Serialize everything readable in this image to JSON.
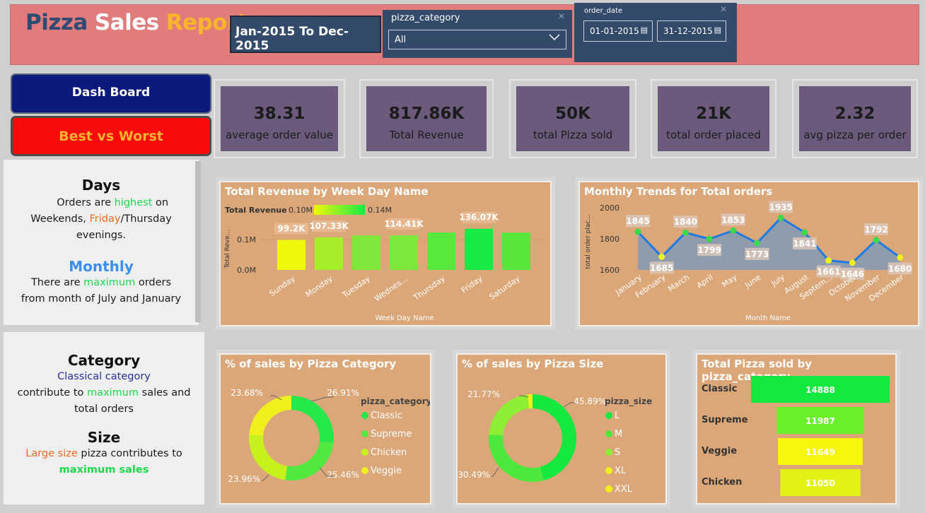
{
  "header": {
    "title_words": [
      "Pizza",
      "Sales",
      "Report"
    ],
    "title_colors": [
      "#2f4a73",
      "#ffffff",
      "#f8b52c"
    ],
    "date_range": "Jan-2015 To Dec-2015",
    "category_slicer": {
      "label": "pizza_category",
      "value": "All"
    },
    "date_slicer": {
      "label": "order_date",
      "from": "01-01-2015",
      "to": "31-12-2015"
    }
  },
  "nav": {
    "dashboard": "Dash Board",
    "best_worst": "Best vs Worst"
  },
  "kpis": [
    {
      "value": "38.31",
      "label": "average order value"
    },
    {
      "value": "817.86K",
      "label": "Total Revenue"
    },
    {
      "value": "50K",
      "label": "total Pizza sold"
    },
    {
      "value": "21K",
      "label": "total order placed"
    },
    {
      "value": "2.32",
      "label": "avg pizza per order"
    }
  ],
  "insights": {
    "days_title": "Days",
    "days_p1": "Orders are ",
    "days_hl1": "highest",
    "days_p2": " on",
    "days_p3": "Weekends, ",
    "days_hl2": "Friday",
    "days_p4": "/Thursday",
    "days_p5": "evenings.",
    "monthly_title": "Monthly",
    "monthly_p1": "There are ",
    "monthly_hl": "maximum",
    "monthly_p2": " orders",
    "monthly_p3": "from month of July and January",
    "category_title": "Category",
    "category_hl1": "Classical category",
    "category_p1": "contribute to ",
    "category_hl2": "maximum",
    "category_p2": " sales and",
    "category_p3": "total orders",
    "size_title": "Size",
    "size_hl1": "Large size",
    "size_p1": " pizza contributes to",
    "size_hl2": "maximum sales"
  },
  "chart_data": [
    {
      "type": "bar",
      "title": "Total Revenue by Week Day Name",
      "xlabel": "Week Day Name",
      "ylabel": "Total Reve...",
      "legend_title": "Total Revenue",
      "legend_min": "0.10M",
      "legend_max": "0.14M",
      "yticks": [
        "0.0M",
        "0.1M"
      ],
      "ylim": [
        0,
        140000
      ],
      "categories": [
        "Sunday",
        "Monday",
        "Tuesday",
        "Wednes...",
        "Thursday",
        "Friday",
        "Saturday"
      ],
      "values": [
        99200,
        107330,
        114000,
        114410,
        123500,
        136070,
        123200
      ],
      "data_labels": [
        "99.2K",
        "107.33K",
        "",
        "114.41K",
        "",
        "136.07K",
        ""
      ],
      "colors": [
        "#eef80a",
        "#a6ee2a",
        "#7de83a",
        "#7be83b",
        "#57e83d",
        "#17ea45",
        "#58e53c"
      ]
    },
    {
      "type": "line",
      "title": "Monthly Trends for Total orders",
      "xlabel": "Month Name",
      "ylabel": "total order plac...",
      "yticks": [
        "1600",
        "1800",
        "2000"
      ],
      "ylim": [
        1600,
        2000
      ],
      "categories": [
        "January",
        "February",
        "March",
        "April",
        "May",
        "June",
        "July",
        "August",
        "Septem...",
        "October",
        "November",
        "December"
      ],
      "values": [
        1845,
        1685,
        1840,
        1799,
        1853,
        1773,
        1935,
        1841,
        1661,
        1646,
        1792,
        1680
      ],
      "point_colors": [
        "#3cd94a",
        "#f0f01c",
        "#3cd94a",
        "#3cd94a",
        "#3cd94a",
        "#3cd94a",
        "#3cd94a",
        "#3cd94a",
        "#f0f01c",
        "#f0f01c",
        "#3cd94a",
        "#f0f01c"
      ]
    },
    {
      "type": "pie",
      "title": "% of sales by Pizza Category",
      "legend_title": "pizza_category",
      "categories": [
        "Classic",
        "Supreme",
        "Chicken",
        "Veggie"
      ],
      "values": [
        26.91,
        25.46,
        23.96,
        23.68
      ],
      "labels": [
        "26.91%",
        "25.46%",
        "23.96%",
        "23.68%"
      ],
      "colors": [
        "#26e84a",
        "#51e83f",
        "#c6f11c",
        "#f0f01c"
      ]
    },
    {
      "type": "pie",
      "title": "% of sales by Pizza Size",
      "legend_title": "pizza_size",
      "categories": [
        "L",
        "M",
        "S",
        "XL",
        "XXL"
      ],
      "values": [
        45.89,
        30.49,
        21.77,
        1.72,
        0.12
      ],
      "labels": [
        "45.89%",
        "30.49%",
        "21.77%"
      ],
      "colors": [
        "#12e83e",
        "#4ee83d",
        "#8dee33",
        "#f0f01c",
        "#f0f01c"
      ]
    },
    {
      "type": "bar",
      "title": "Total Pizza sold by pizza_category",
      "categories": [
        "Classic",
        "Supreme",
        "Veggie",
        "Chicken"
      ],
      "values": [
        14888,
        11987,
        11649,
        11050
      ],
      "labels": [
        "14888",
        "11987",
        "11649",
        "11050"
      ],
      "colors": [
        "#12e83e",
        "#6bf02a",
        "#f7f50c",
        "#e2f314"
      ]
    }
  ]
}
